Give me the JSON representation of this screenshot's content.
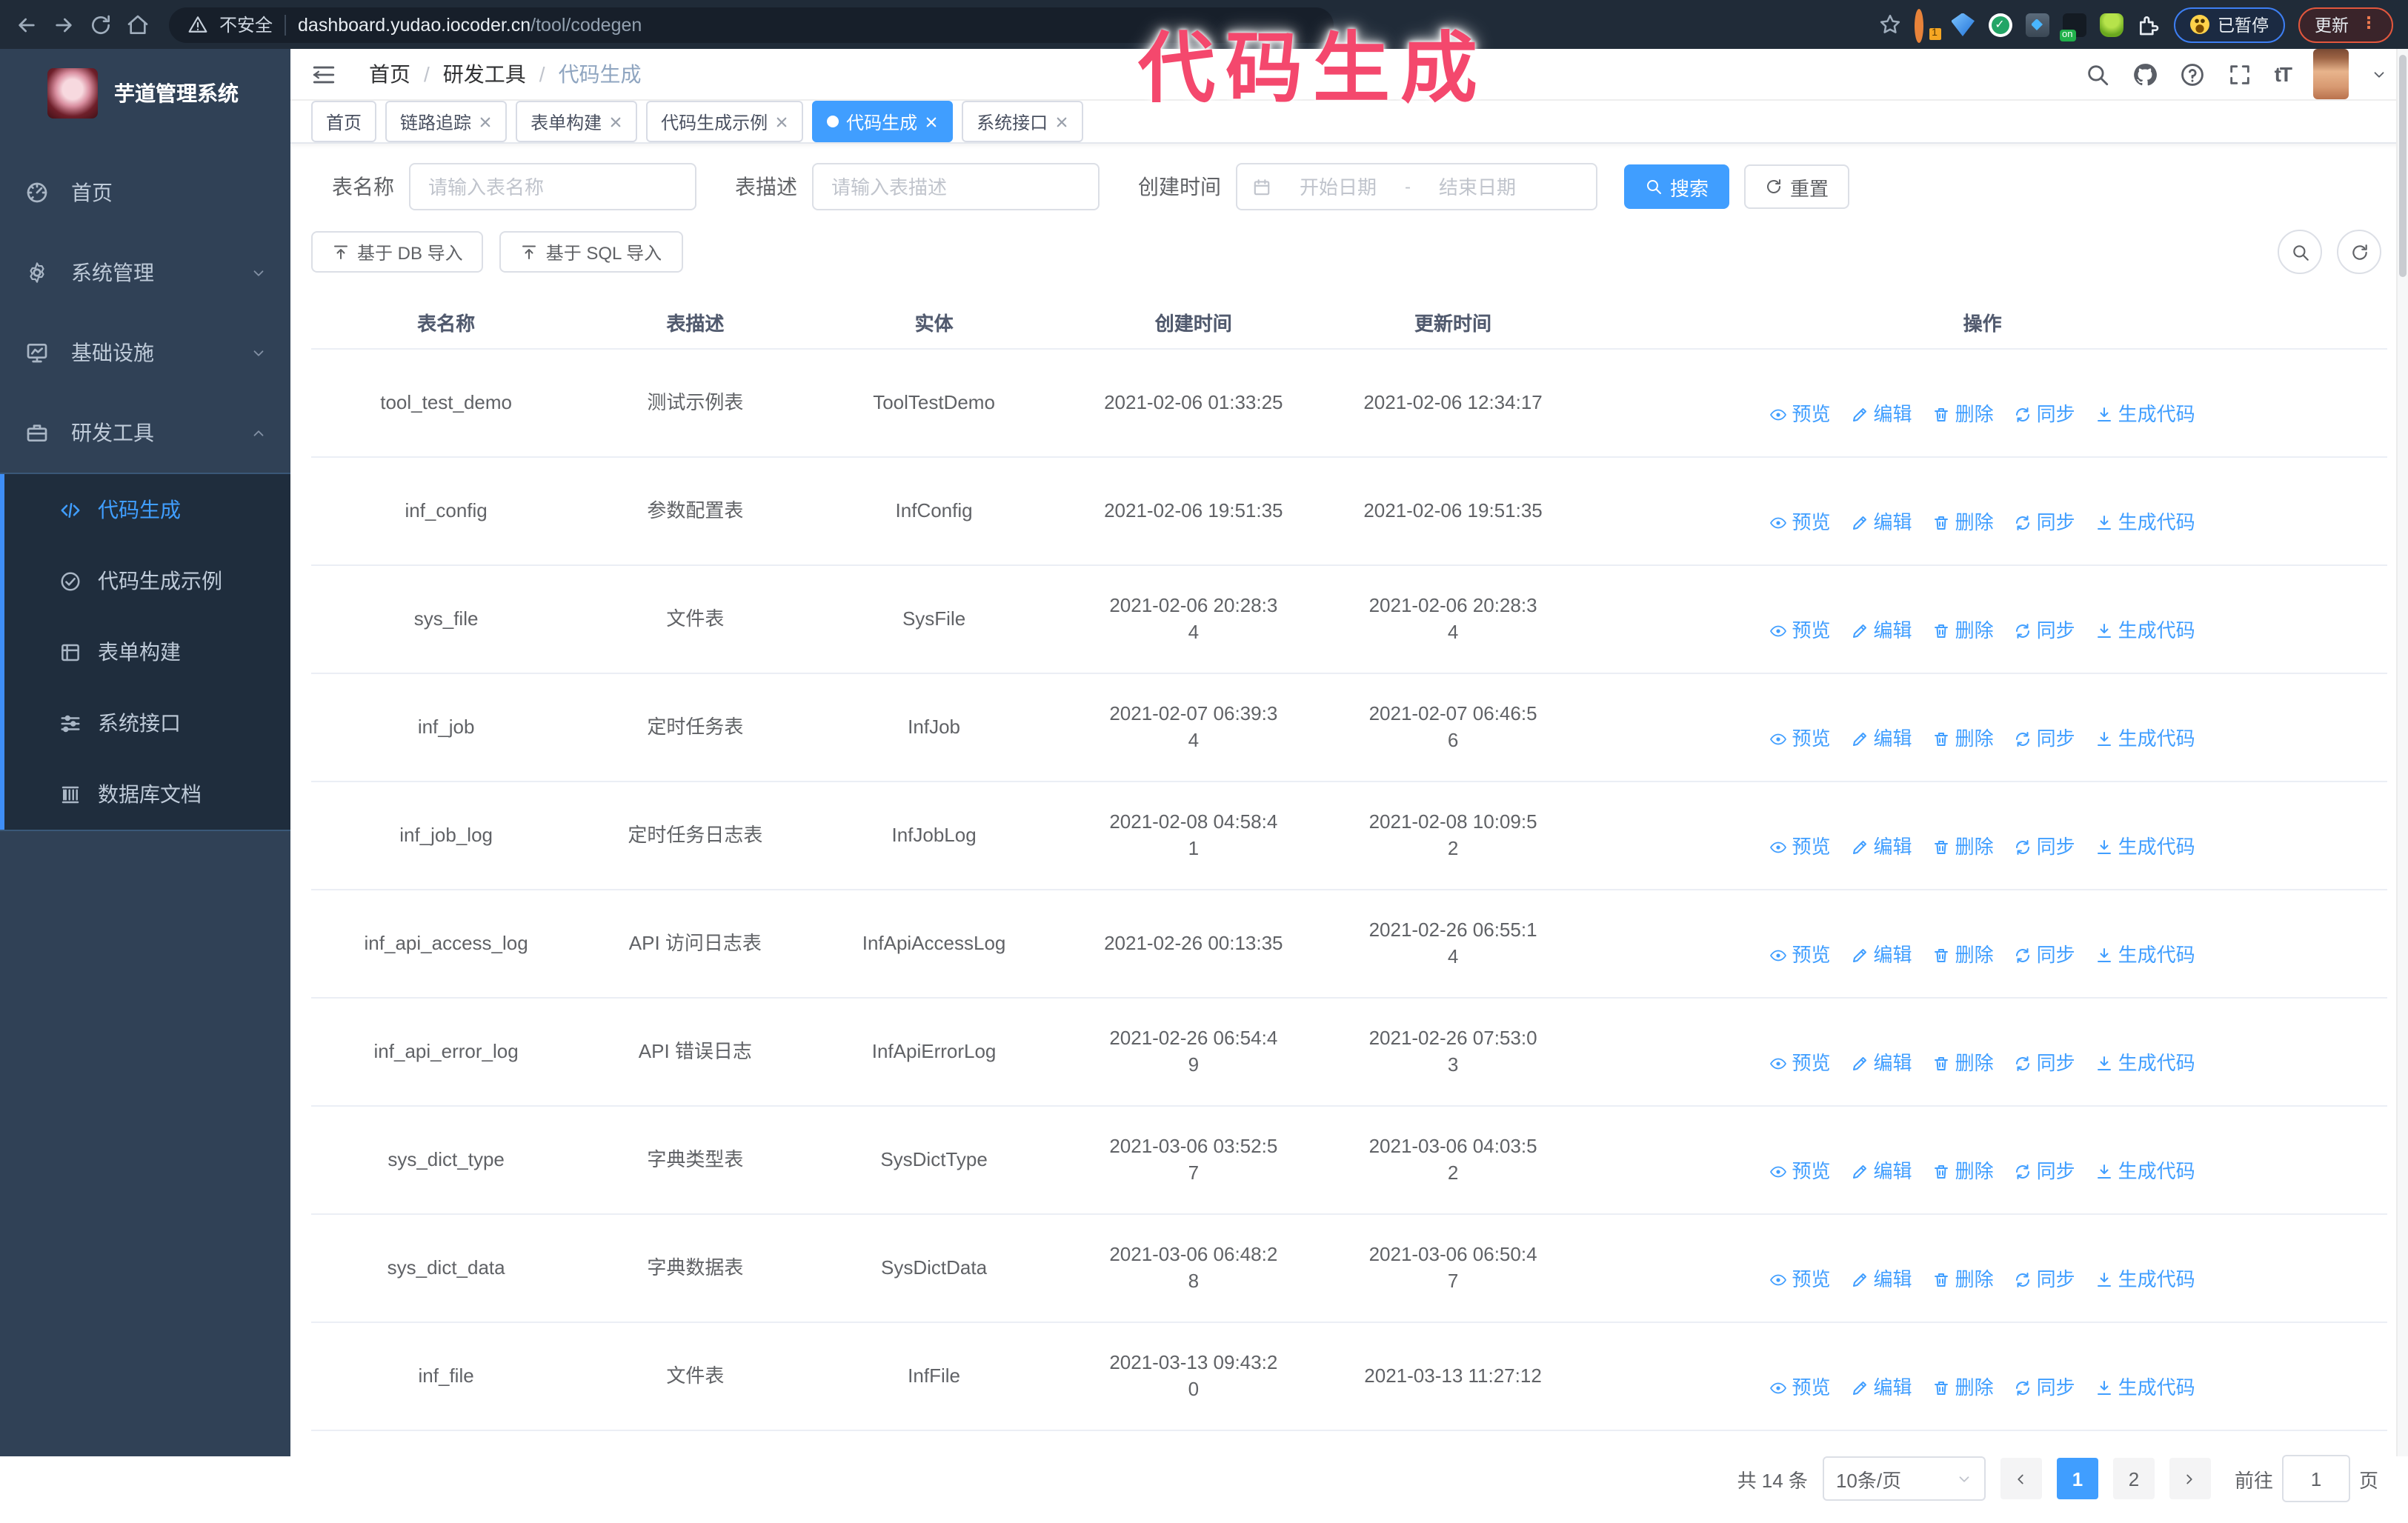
{
  "annotation": {
    "text": "代码生成"
  },
  "browser": {
    "security_label": "不安全",
    "url_host": "dashboard.yudao.iocoder.cn",
    "url_path": "/tool/codegen",
    "ext_badge_1": "1",
    "ext_badge_on": "on",
    "paused_label": "已暂停",
    "update_label": "更新"
  },
  "sidebar": {
    "title": "芋道管理系统",
    "menu": [
      {
        "label": "首页"
      },
      {
        "label": "系统管理"
      },
      {
        "label": "基础设施"
      },
      {
        "label": "研发工具"
      }
    ],
    "submenu": [
      {
        "label": "代码生成"
      },
      {
        "label": "代码生成示例"
      },
      {
        "label": "表单构建"
      },
      {
        "label": "系统接口"
      },
      {
        "label": "数据库文档"
      }
    ]
  },
  "header": {
    "breadcrumb": [
      "首页",
      "研发工具",
      "代码生成"
    ],
    "separator": "/"
  },
  "tabs": [
    {
      "label": "首页"
    },
    {
      "label": "链路追踪"
    },
    {
      "label": "表单构建"
    },
    {
      "label": "代码生成示例"
    },
    {
      "label": "代码生成"
    },
    {
      "label": "系统接口"
    }
  ],
  "filters": {
    "name_label": "表名称",
    "name_placeholder": "请输入表名称",
    "desc_label": "表描述",
    "desc_placeholder": "请输入表描述",
    "time_label": "创建时间",
    "start_placeholder": "开始日期",
    "range_separator": "-",
    "end_placeholder": "结束日期",
    "search_label": "搜索",
    "reset_label": "重置"
  },
  "toolbar": {
    "import_db": "基于 DB 导入",
    "import_sql": "基于 SQL 导入"
  },
  "table": {
    "columns": [
      "表名称",
      "表描述",
      "实体",
      "创建时间",
      "更新时间",
      "操作"
    ],
    "actions": [
      "预览",
      "编辑",
      "删除",
      "同步",
      "生成代码"
    ],
    "rows": [
      {
        "name": "tool_test_demo",
        "desc": "测试示例表",
        "entity": "ToolTestDemo",
        "created": "2021-02-06 01:33:25",
        "updated": "2021-02-06 12:34:17"
      },
      {
        "name": "inf_config",
        "desc": "参数配置表",
        "entity": "InfConfig",
        "created": "2021-02-06 19:51:35",
        "updated": "2021-02-06 19:51:35"
      },
      {
        "name": "sys_file",
        "desc": "文件表",
        "entity": "SysFile",
        "created": "2021-02-06 20:28:3\n4",
        "updated": "2021-02-06 20:28:3\n4"
      },
      {
        "name": "inf_job",
        "desc": "定时任务表",
        "entity": "InfJob",
        "created": "2021-02-07 06:39:3\n4",
        "updated": "2021-02-07 06:46:5\n6"
      },
      {
        "name": "inf_job_log",
        "desc": "定时任务日志表",
        "entity": "InfJobLog",
        "created": "2021-02-08 04:58:4\n1",
        "updated": "2021-02-08 10:09:5\n2"
      },
      {
        "name": "inf_api_access_log",
        "desc": "API 访问日志表",
        "entity": "InfApiAccessLog",
        "created": "2021-02-26 00:13:35",
        "updated": "2021-02-26 06:55:1\n4"
      },
      {
        "name": "inf_api_error_log",
        "desc": "API 错误日志",
        "entity": "InfApiErrorLog",
        "created": "2021-02-26 06:54:4\n9",
        "updated": "2021-02-26 07:53:0\n3"
      },
      {
        "name": "sys_dict_type",
        "desc": "字典类型表",
        "entity": "SysDictType",
        "created": "2021-03-06 03:52:5\n7",
        "updated": "2021-03-06 04:03:5\n2"
      },
      {
        "name": "sys_dict_data",
        "desc": "字典数据表",
        "entity": "SysDictData",
        "created": "2021-03-06 06:48:2\n8",
        "updated": "2021-03-06 06:50:4\n7"
      },
      {
        "name": "inf_file",
        "desc": "文件表",
        "entity": "InfFile",
        "created": "2021-03-13 09:43:2\n0",
        "updated": "2021-03-13 11:27:12"
      }
    ]
  },
  "pagination": {
    "total": "共 14 条",
    "page_size": "10条/页",
    "page_1": "1",
    "page_2": "2",
    "goto_label": "前往",
    "goto_value": "1",
    "goto_suffix": "页"
  },
  "colors": {
    "accent": "#409eff",
    "sidebar_bg": "#304156",
    "submenu_bg": "#1f2d3d",
    "annotation": "#f4486d"
  }
}
